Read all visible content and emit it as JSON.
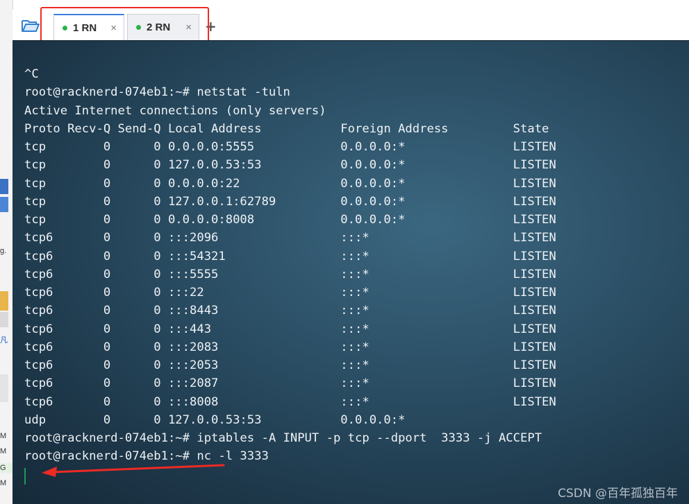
{
  "tabs": [
    {
      "label": "1 RN",
      "status_color": "#2bb24c",
      "active": true
    },
    {
      "label": "2 RN",
      "status_color": "#2bb24c",
      "active": false
    }
  ],
  "tab_close_glyph": "×",
  "new_tab_glyph": "+",
  "left_strip_fragments": [
    "g.",
    "凡",
    "M",
    "M",
    "G",
    "M"
  ],
  "terminal": {
    "lines": [
      "^C",
      "root@racknerd-074eb1:~# netstat -tuln",
      "Active Internet connections (only servers)",
      "Proto Recv-Q Send-Q Local Address           Foreign Address         State",
      "tcp        0      0 0.0.0.0:5555            0.0.0.0:*               LISTEN",
      "tcp        0      0 127.0.0.53:53           0.0.0.0:*               LISTEN",
      "tcp        0      0 0.0.0.0:22              0.0.0.0:*               LISTEN",
      "tcp        0      0 127.0.0.1:62789         0.0.0.0:*               LISTEN",
      "tcp        0      0 0.0.0.0:8008            0.0.0.0:*               LISTEN",
      "tcp6       0      0 :::2096                 :::*                    LISTEN",
      "tcp6       0      0 :::54321                :::*                    LISTEN",
      "tcp6       0      0 :::5555                 :::*                    LISTEN",
      "tcp6       0      0 :::22                   :::*                    LISTEN",
      "tcp6       0      0 :::8443                 :::*                    LISTEN",
      "tcp6       0      0 :::443                  :::*                    LISTEN",
      "tcp6       0      0 :::2083                 :::*                    LISTEN",
      "tcp6       0      0 :::2053                 :::*                    LISTEN",
      "tcp6       0      0 :::2087                 :::*                    LISTEN",
      "tcp6       0      0 :::8008                 :::*                    LISTEN",
      "udp        0      0 127.0.0.53:53           0.0.0.0:*",
      "root@racknerd-074eb1:~# iptables -A INPUT -p tcp --dport  3333 -j ACCEPT",
      "root@racknerd-074eb1:~# nc -l 3333"
    ]
  },
  "watermark": "CSDN @百年孤独百年",
  "colors": {
    "annotation_red": "#ee2a24",
    "terminal_text": "#eef2f5",
    "cursor": "#1f9a56",
    "tab_active_accent": "#3b7ddd"
  }
}
